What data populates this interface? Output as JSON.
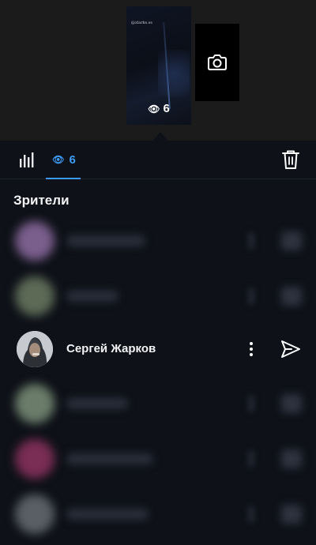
{
  "story": {
    "caption": "@zlarks.ss",
    "view_count": "6"
  },
  "tabs": {
    "viewers_count": "6"
  },
  "section": {
    "title": "Зрители"
  },
  "viewers": [
    {
      "visible": false,
      "avatar_color": "#7a5e8c"
    },
    {
      "visible": false,
      "avatar_color": "#5c6a56"
    },
    {
      "visible": true,
      "name": "Сергей Жарков"
    },
    {
      "visible": false,
      "avatar_color": "#6b7d6a"
    },
    {
      "visible": false,
      "avatar_color": "#7a2d55"
    },
    {
      "visible": false,
      "avatar_color": "#5a5f66"
    }
  ],
  "colors": {
    "accent": "#3d9bf5",
    "background": "#0e1118",
    "top_background": "#1b1b1c"
  },
  "icons": {
    "stats": "bar-chart-icon",
    "views": "eye-icon",
    "delete": "trash-icon",
    "camera": "camera-icon",
    "more": "more-vertical-icon",
    "send": "send-icon"
  }
}
